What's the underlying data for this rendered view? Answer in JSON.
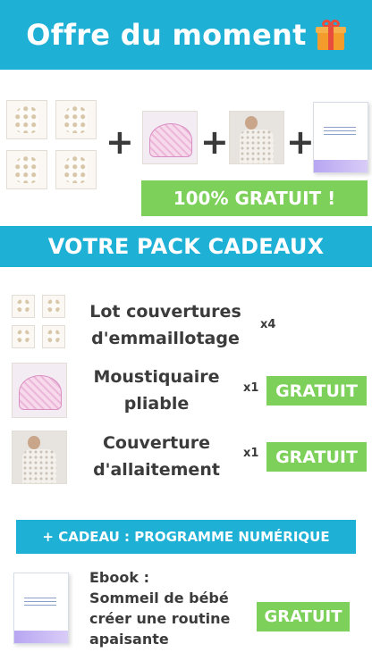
{
  "header": {
    "title": "Offre du moment",
    "icon": "gift-icon"
  },
  "offer_row": {
    "images": [
      "swaddle-blankets-image",
      "mosquito-net-image",
      "nursing-cover-image",
      "ebook-cover-image"
    ],
    "plus_symbol": "+"
  },
  "free_badge": "100% GRATUIT !",
  "pack_title": "VOTRE PACK CADEAUX",
  "items": [
    {
      "name_line1": "Lot couvertures",
      "name_line2": "d'emmaillotage",
      "qty": "x4",
      "badge": ""
    },
    {
      "name_line1": "Moustiquaire",
      "name_line2": "pliable",
      "qty": "x1",
      "badge": "GRATUIT"
    },
    {
      "name_line1": "Couverture",
      "name_line2": "d'allaitement",
      "qty": "x1",
      "badge": "GRATUIT"
    }
  ],
  "digital_bar": "+ CADEAU : PROGRAMME NUMÉRIQUE",
  "ebook": {
    "lines": [
      "Ebook :",
      "Sommeil de bébé",
      "créer une routine",
      "apaisante"
    ],
    "badge": "GRATUIT"
  },
  "colors": {
    "accent_blue": "#1fb0d6",
    "accent_green": "#7dd05a"
  }
}
